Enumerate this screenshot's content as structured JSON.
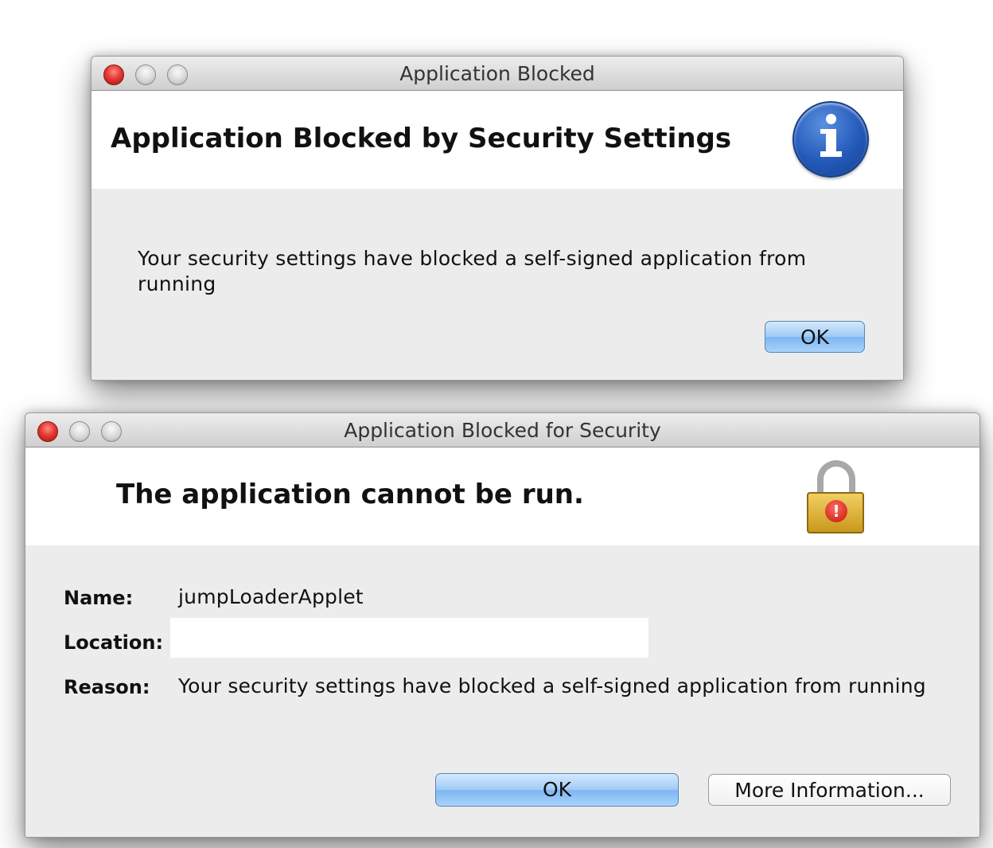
{
  "dialog1": {
    "window_title": "Application Blocked",
    "heading": "Application Blocked by Security Settings",
    "message": "Your security settings have blocked a self-signed application from running",
    "ok_label": "OK"
  },
  "dialog2": {
    "window_title": "Application Blocked for Security",
    "heading": "The application cannot be run.",
    "name_label": "Name:",
    "name_value": "jumpLoaderApplet",
    "location_label": "Location:",
    "location_value": "",
    "reason_label": "Reason:",
    "reason_value": "Your security settings have blocked a self-signed application from running",
    "ok_label": "OK",
    "more_info_label": "More Information..."
  },
  "icons": {
    "dialog1_header": "info-icon",
    "dialog2_header": "lock-warning-icon"
  },
  "colors": {
    "close_button": "#e53935",
    "primary_button": "#9fcaf6",
    "info_icon": "#2359b9",
    "lock_body": "#e0b53a",
    "alert_badge": "#d11a10"
  }
}
